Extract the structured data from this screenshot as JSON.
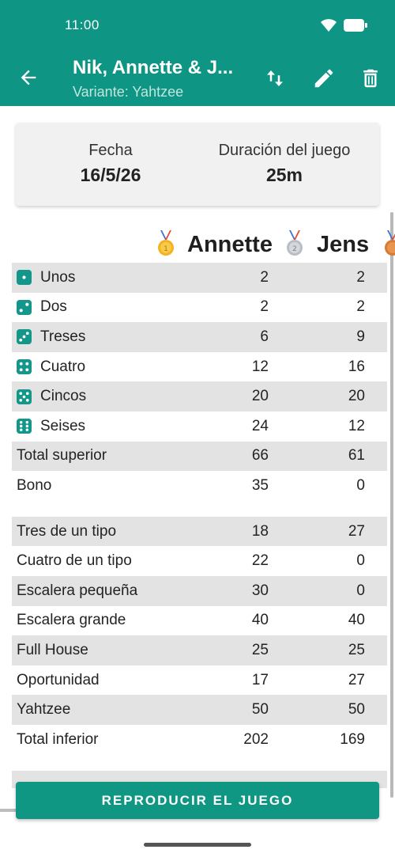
{
  "status_bar": {
    "time": "11:00"
  },
  "app_bar": {
    "title": "Nik, Annette & J...",
    "subtitle": "Variante: Yahtzee"
  },
  "info": {
    "date_label": "Fecha",
    "date_value": "16/5/26",
    "duration_label": "Duración del juego",
    "duration_value": "25m"
  },
  "players": [
    {
      "name": "Annette",
      "medal": "gold-medal-icon"
    },
    {
      "name": "Jens",
      "medal": "silver-medal-icon"
    }
  ],
  "rows": [
    {
      "label": "Unos",
      "icon": "dice-one-icon",
      "v1": "2",
      "v2": "2",
      "shaded": true
    },
    {
      "label": "Dos",
      "icon": "dice-two-icon",
      "v1": "2",
      "v2": "2",
      "shaded": false
    },
    {
      "label": "Treses",
      "icon": "dice-three-icon",
      "v1": "6",
      "v2": "9",
      "shaded": true
    },
    {
      "label": "Cuatro",
      "icon": "dice-four-icon",
      "v1": "12",
      "v2": "16",
      "shaded": false
    },
    {
      "label": "Cincos",
      "icon": "dice-five-icon",
      "v1": "20",
      "v2": "20",
      "shaded": true
    },
    {
      "label": "Seises",
      "icon": "dice-six-icon",
      "v1": "24",
      "v2": "12",
      "shaded": false
    },
    {
      "label": "Total superior",
      "v1": "66",
      "v2": "61",
      "shaded": true
    },
    {
      "label": "Bono",
      "v1": "35",
      "v2": "0",
      "shaded": false
    },
    {
      "label": "Tres de un tipo",
      "v1": "18",
      "v2": "27",
      "shaded": true
    },
    {
      "label": "Cuatro de un tipo",
      "v1": "22",
      "v2": "0",
      "shaded": false
    },
    {
      "label": "Escalera pequeña",
      "v1": "30",
      "v2": "0",
      "shaded": true
    },
    {
      "label": "Escalera grande",
      "v1": "40",
      "v2": "40",
      "shaded": false
    },
    {
      "label": "Full House",
      "v1": "25",
      "v2": "25",
      "shaded": true
    },
    {
      "label": "Oportunidad",
      "v1": "17",
      "v2": "27",
      "shaded": false
    },
    {
      "label": "Yahtzee",
      "v1": "50",
      "v2": "50",
      "shaded": true
    },
    {
      "label": "Total inferior",
      "v1": "202",
      "v2": "169",
      "shaded": false
    }
  ],
  "play_button": {
    "label": "REPRODUCIR EL JUEGO"
  },
  "colors": {
    "primary": "#0f9584",
    "row_shade": "#e3e3e3",
    "dice": "#13978a"
  }
}
